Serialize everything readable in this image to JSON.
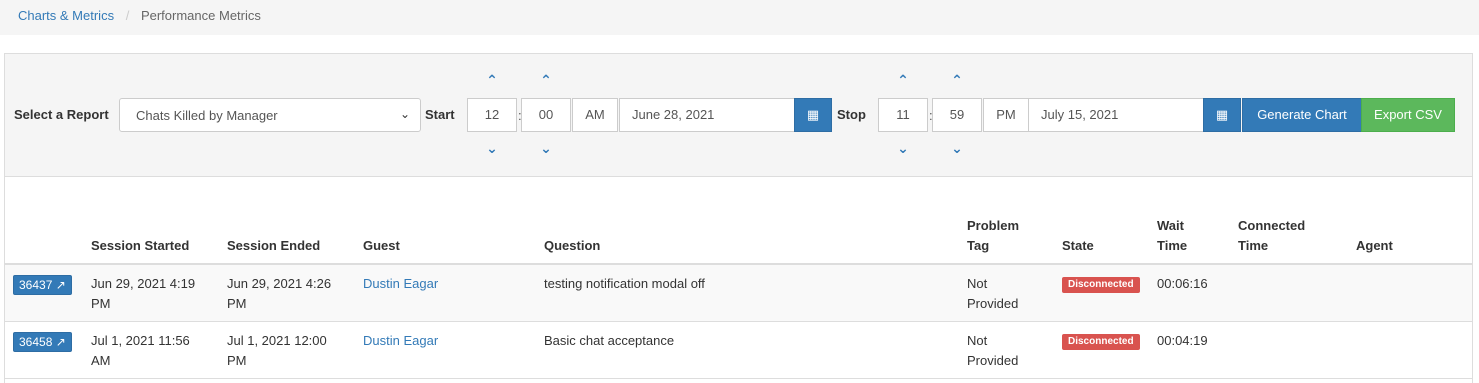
{
  "breadcrumb": {
    "parent": "Charts & Metrics",
    "current": "Performance Metrics",
    "separator": "/"
  },
  "filters": {
    "report_label": "Select a Report",
    "report_value": "Chats Killed by Manager",
    "start_label": "Start",
    "start_hour": "12",
    "start_minute": "00",
    "start_ampm": "AM",
    "start_date": "June 28, 2021",
    "stop_label": "Stop",
    "stop_hour": "11",
    "stop_minute": "59",
    "stop_ampm": "PM",
    "stop_date": "July 15, 2021",
    "colon": ":",
    "up_icon": "chevron-up-icon",
    "down_icon": "chevron-down-icon",
    "calendar_icon": "calendar-icon"
  },
  "buttons": {
    "generate": "Generate Chart",
    "export": "Export CSV"
  },
  "table": {
    "headers": {
      "session_started": "Session Started",
      "session_ended": "Session Ended",
      "guest": "Guest",
      "question": "Question",
      "problem_tag_1": "Problem",
      "problem_tag_2": "Tag",
      "state": "State",
      "wait_1": "Wait",
      "wait_2": "Time",
      "connected_1": "Connected",
      "connected_2": "Time",
      "agent": "Agent"
    },
    "rows": [
      {
        "id": "36437",
        "started_1": "Jun 29, 2021 4:19",
        "started_2": "PM",
        "ended_1": "Jun 29, 2021 4:26",
        "ended_2": "PM",
        "guest": "Dustin Eagar",
        "question": "testing notification modal off",
        "tag_1": "Not",
        "tag_2": "Provided",
        "state": "Disconnected",
        "wait": "00:06:16",
        "connected": "",
        "agent": ""
      },
      {
        "id": "36458",
        "started_1": "Jul 1, 2021 11:56",
        "started_2": "AM",
        "ended_1": "Jul 1, 2021 12:00",
        "ended_2": "PM",
        "guest": "Dustin Eagar",
        "question": "Basic chat acceptance",
        "tag_1": "Not",
        "tag_2": "Provided",
        "state": "Disconnected",
        "wait": "00:04:19",
        "connected": "",
        "agent": ""
      }
    ]
  },
  "colors": {
    "primary": "#337ab7",
    "success": "#5cb85c",
    "danger": "#d9534f"
  }
}
